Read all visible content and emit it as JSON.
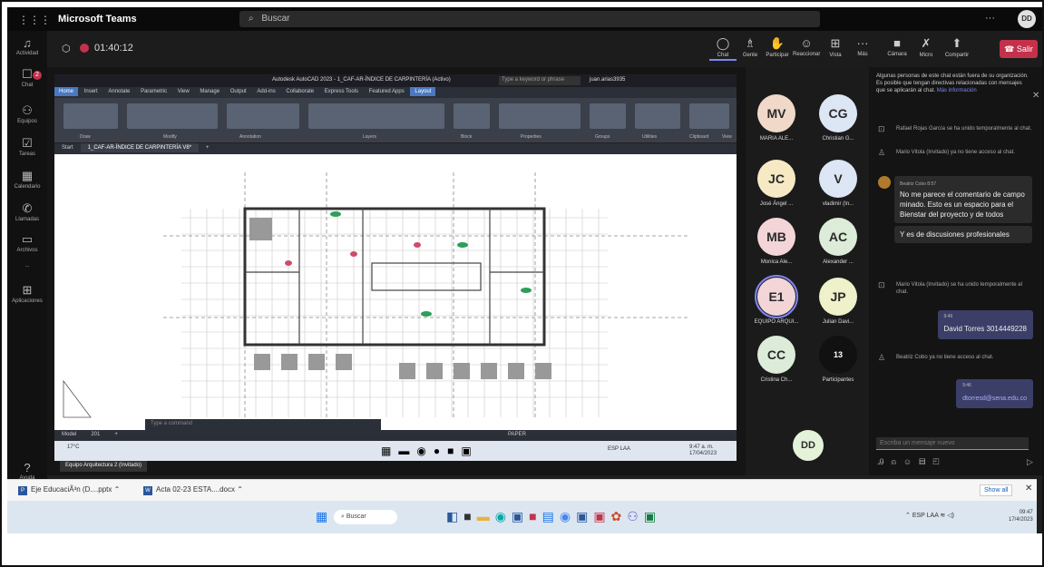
{
  "app": {
    "name": "Microsoft Teams",
    "search_placeholder": "Buscar",
    "user_initials": "DD"
  },
  "rail": [
    {
      "label": "Actividad",
      "icon": "bell-icon"
    },
    {
      "label": "Chat",
      "icon": "chat-icon",
      "badge": "2"
    },
    {
      "label": "Equipos",
      "icon": "teams-icon"
    },
    {
      "label": "Tareas",
      "icon": "tasks-icon"
    },
    {
      "label": "Calendario",
      "icon": "calendar-icon"
    },
    {
      "label": "Llamadas",
      "icon": "phone-icon"
    },
    {
      "label": "Archivos",
      "icon": "files-icon"
    },
    {
      "label": "...",
      "icon": "more-icon"
    },
    {
      "label": "Aplicaciones",
      "icon": "apps-icon"
    },
    {
      "label": "Ayuda",
      "icon": "help-icon"
    }
  ],
  "call": {
    "timer": "01:40:12",
    "controls": [
      "Chat",
      "Gente",
      "Participar",
      "Reaccionar",
      "Vista",
      "Más"
    ],
    "media": [
      "Cámara",
      "Micro",
      "Compartir"
    ],
    "leave_label": "Salir"
  },
  "autocad": {
    "title": "Autodesk AutoCAD 2023 - 1_CAF-AR-ÍNDICE DE CARPINTERÍA (Activo)",
    "search_placeholder": "Type a keyword or phrase",
    "user": "juan.arias3935",
    "ribbon_tabs": [
      "Home",
      "Insert",
      "Annotate",
      "Parametric",
      "View",
      "Manage",
      "Output",
      "Add-ins",
      "Collaborate",
      "Express Tools",
      "Featured Apps",
      "Layout"
    ],
    "ribbon_groups": [
      "Draw",
      "Modify",
      "Annotation",
      "Layers",
      "Block",
      "Properties",
      "Groups",
      "Utilities",
      "Clipboard",
      "View"
    ],
    "doc_tabs": [
      "Start",
      "1_CAF-AR-ÍNDICE DE CARPINTERÍA V8*"
    ],
    "command_placeholder": "Type a command",
    "layout_tabs": [
      "Model",
      "201"
    ],
    "paper_label": "PAPER",
    "shared_taskbar": {
      "weather": "17°C",
      "lang": "ESP LAA",
      "time": "9:47 a. m.",
      "date": "17/04/2023"
    },
    "presenter_label": "Equipo Arquitectura 2 (Invitado)"
  },
  "participants": [
    {
      "initials": "MV",
      "name": "MARIA ALE...",
      "color": "#f0d9c9"
    },
    {
      "initials": "CG",
      "name": "Christian G...",
      "color": "#dce6f4"
    },
    {
      "initials": "JC",
      "name": "José Ángel ...",
      "color": "#f6e9c4"
    },
    {
      "initials": "V",
      "name": "vladimir (In...",
      "color": "#dce6f4"
    },
    {
      "initials": "MB",
      "name": "Monica Ale...",
      "color": "#f3d5d8"
    },
    {
      "initials": "AC",
      "name": "Alexander ...",
      "color": "#dcecd9"
    },
    {
      "initials": "E1",
      "name": "EQUIPO ARQUI...",
      "color": "#f3d5d8"
    },
    {
      "initials": "JP",
      "name": "Julian Davi...",
      "color": "#eef1c9"
    },
    {
      "initials": "CC",
      "name": "Cristina Ch...",
      "color": "#dcecd9"
    },
    {
      "initials": "13",
      "name": "Participantes",
      "color": "#111111"
    }
  ],
  "self_initials": "DD",
  "chat": {
    "notice": "Algunas personas de este chat están fuera de su organización. Es posible que tengan directivas relacionadas con mensajes que se aplicarán al chat.",
    "notice_more": "Más información",
    "events": [
      "Rafael Rojas García se ha unido temporalmente al chat.",
      "Mario Vitola (Invitado) ya no tiene acceso al chat."
    ],
    "beatriz_header": "Beatriz Cobo 8:57",
    "beatriz_msg1": "No me parece el comentario de campo minado. Esto es un espacio para el Bienstar del proyecto y de todos",
    "beatriz_msg2": "Y es de discusiones profesionales",
    "events2": [
      "Mario Vitola (Invitado) se ha unido temporalmente al chat.",
      "Beatriz Cobo ya no tiene acceso al chat."
    ],
    "my_msg1_time": "9:46",
    "my_msg1": "David Torres 3014449228",
    "my_msg2_time": "9:46",
    "my_msg2": "dtorresd@sena.edu.co",
    "compose_placeholder": "Escriba un mensaje nuevo"
  },
  "downloads": [
    {
      "name": "Eje EducaciÃ³n (D....pptx"
    },
    {
      "name": "Acta 02-23 ESTA....docx"
    }
  ],
  "downloads_show_all": "Show all",
  "taskbar": {
    "search": "Buscar",
    "lang": "ESP LAA",
    "time": "09:47",
    "date": "17/4/2023"
  }
}
